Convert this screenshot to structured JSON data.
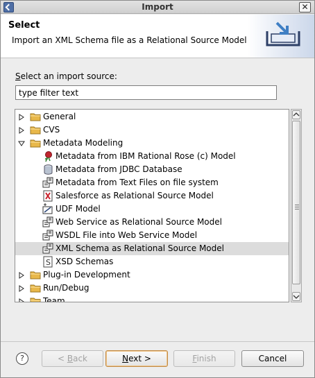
{
  "window": {
    "title": "Import"
  },
  "banner": {
    "heading": "Select",
    "description": "Import an XML Schema file as a Relational Source Model"
  },
  "filter": {
    "label_prefix": "S",
    "label_rest": "elect an import source:",
    "value": "type filter text"
  },
  "tree": {
    "items": [
      {
        "label": "General",
        "level": 0,
        "expanded": false,
        "icon": "folder-icon"
      },
      {
        "label": "CVS",
        "level": 0,
        "expanded": false,
        "icon": "folder-icon"
      },
      {
        "label": "Metadata Modeling",
        "level": 0,
        "expanded": true,
        "icon": "folder-icon"
      },
      {
        "label": "Metadata from IBM Rational Rose (c) Model",
        "level": 1,
        "icon": "rose-icon"
      },
      {
        "label": "Metadata from JDBC Database",
        "level": 1,
        "icon": "database-icon"
      },
      {
        "label": "Metadata from Text Files on file system",
        "level": 1,
        "icon": "import-wizard-icon"
      },
      {
        "label": "Salesforce as Relational Source Model",
        "level": 1,
        "icon": "salesforce-icon"
      },
      {
        "label": "UDF Model",
        "level": 1,
        "icon": "udf-icon"
      },
      {
        "label": "Web Service as Relational Source Model",
        "level": 1,
        "icon": "import-wizard-icon"
      },
      {
        "label": "WSDL File into Web Service Model",
        "level": 1,
        "icon": "import-wizard-icon"
      },
      {
        "label": "XML Schema as Relational Source Model",
        "level": 1,
        "icon": "import-wizard-icon",
        "selected": true
      },
      {
        "label": "XSD Schemas",
        "level": 1,
        "icon": "xsd-icon"
      },
      {
        "label": "Plug-in Development",
        "level": 0,
        "expanded": false,
        "icon": "folder-icon"
      },
      {
        "label": "Run/Debug",
        "level": 0,
        "expanded": false,
        "icon": "folder-icon"
      },
      {
        "label": "Team",
        "level": 0,
        "expanded": false,
        "icon": "folder-icon"
      }
    ]
  },
  "buttons": {
    "help": "?",
    "back_mnemonic": "B",
    "back_rest": "ack",
    "back_prefix": "< ",
    "next_mnemonic": "N",
    "next_rest": "ext >",
    "finish_mnemonic": "F",
    "finish_rest": "inish",
    "cancel": "Cancel"
  },
  "colors": {
    "selection": "#dcdcdc",
    "folder": "#e8b84a",
    "default_button_border": "#c08a46"
  }
}
